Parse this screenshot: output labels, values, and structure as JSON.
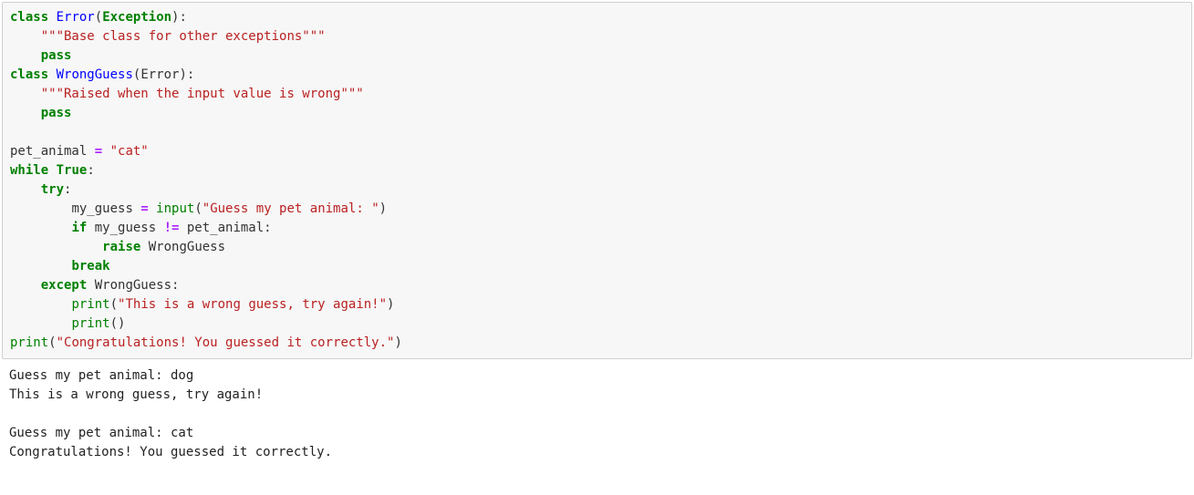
{
  "code": {
    "kw_class1": "class",
    "cls_error": "Error",
    "paren_exc_open": "(",
    "exc_name": "Exception",
    "paren_exc_close": "):",
    "doc_error": "\"\"\"Base class for other exceptions\"\"\"",
    "kw_pass1": "pass",
    "kw_class2": "class",
    "cls_wrong": "WrongGuess",
    "paren_err_open": "(",
    "err_base": "Error",
    "paren_err_close": "):",
    "doc_wrong": "\"\"\"Raised when the input value is wrong\"\"\"",
    "kw_pass2": "pass",
    "pet_lhs": "pet_animal ",
    "op_assign1": "=",
    "pet_val": " \"cat\"",
    "kw_while": "while",
    "true_kw": "True",
    "colon1": ":",
    "kw_try": "try",
    "colon2": ":",
    "guess_lhs": "my_guess ",
    "op_assign2": "=",
    "sp_input": " ",
    "fn_input": "input",
    "input_args_open": "(",
    "input_str": "\"Guess my pet animal: \"",
    "input_args_close": ")",
    "kw_if": "if",
    "if_cond_lhs": " my_guess ",
    "op_neq": "!=",
    "if_cond_rhs": " pet_animal:",
    "kw_raise": "raise",
    "raise_target": " WrongGuess",
    "kw_break": "break",
    "kw_except": "except",
    "except_target": " WrongGuess:",
    "fn_print1": "print",
    "print1_args_open": "(",
    "print1_str": "\"This is a wrong guess, try again!\"",
    "print1_args_close": ")",
    "fn_print2": "print",
    "print2_args": "()",
    "fn_print3": "print",
    "print3_args_open": "(",
    "print3_str": "\"Congratulations! You guessed it correctly.\"",
    "print3_args_close": ")"
  },
  "output": {
    "line1": "Guess my pet animal: dog",
    "line2": "This is a wrong guess, try again!",
    "line3": "",
    "line4": "Guess my pet animal: cat",
    "line5": "Congratulations! You guessed it correctly."
  }
}
